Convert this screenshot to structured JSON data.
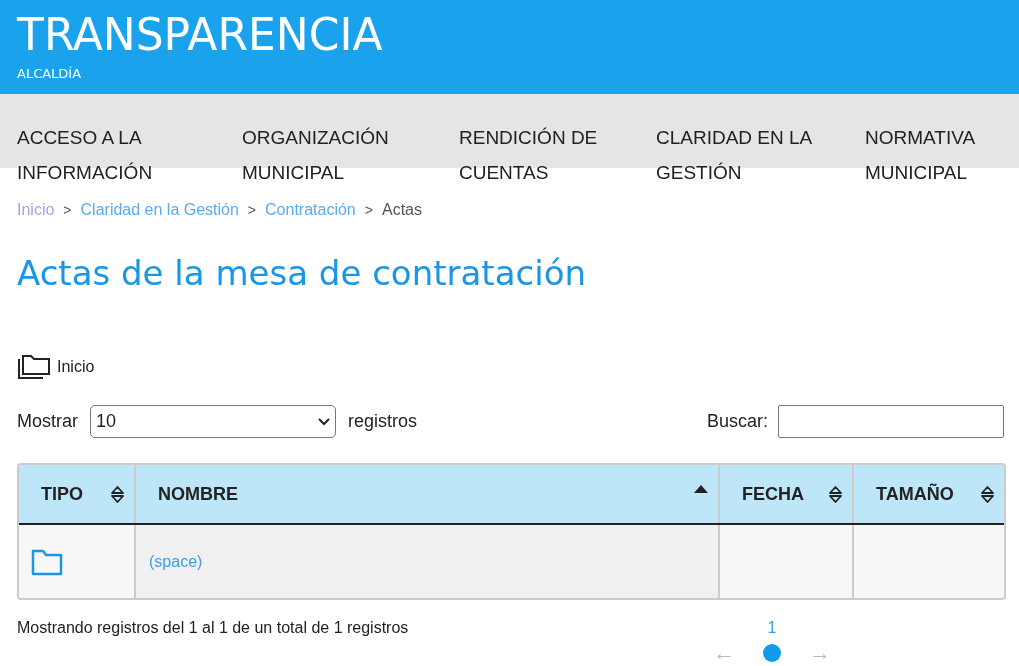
{
  "header": {
    "title": "TRANSPARENCIA",
    "subtitle": "ALCALDÍA"
  },
  "nav": [
    "ACCESO A LA INFORMACIÓN",
    "ORGANIZACIÓN MUNICIPAL",
    "RENDICIÓN DE CUENTAS",
    "CLARIDAD EN LA GESTIÓN",
    "NORMATIVA MUNICIPAL"
  ],
  "breadcrumb": [
    {
      "label": "Inicio",
      "kind": "visited"
    },
    {
      "label": "Claridad en la Gestión",
      "kind": "link"
    },
    {
      "label": "Contratación",
      "kind": "link"
    },
    {
      "label": "Actas",
      "kind": "current"
    }
  ],
  "breadcrumb_separator": ">",
  "page_title": "Actas de la mesa de contratación",
  "folder_path": "Inicio",
  "length_control": {
    "before": "Mostrar",
    "value": "10",
    "after": "registros"
  },
  "search": {
    "label": "Buscar:"
  },
  "table": {
    "columns": [
      {
        "label": "TIPO",
        "sorted": false
      },
      {
        "label": "NOMBRE",
        "sorted": true
      },
      {
        "label": "FECHA",
        "sorted": false
      },
      {
        "label": "TAMAÑO",
        "sorted": false
      }
    ],
    "rows": [
      {
        "kind": "folder",
        "name": "(space)"
      }
    ]
  },
  "info": "Mostrando registros del 1 al 1 de un total de 1 registros",
  "pagination": {
    "pages": [
      {
        "label": "1",
        "selected": true
      }
    ],
    "prev": {
      "label": "←",
      "disabled": true
    },
    "next": {
      "label": "→",
      "disabled": true
    }
  }
}
